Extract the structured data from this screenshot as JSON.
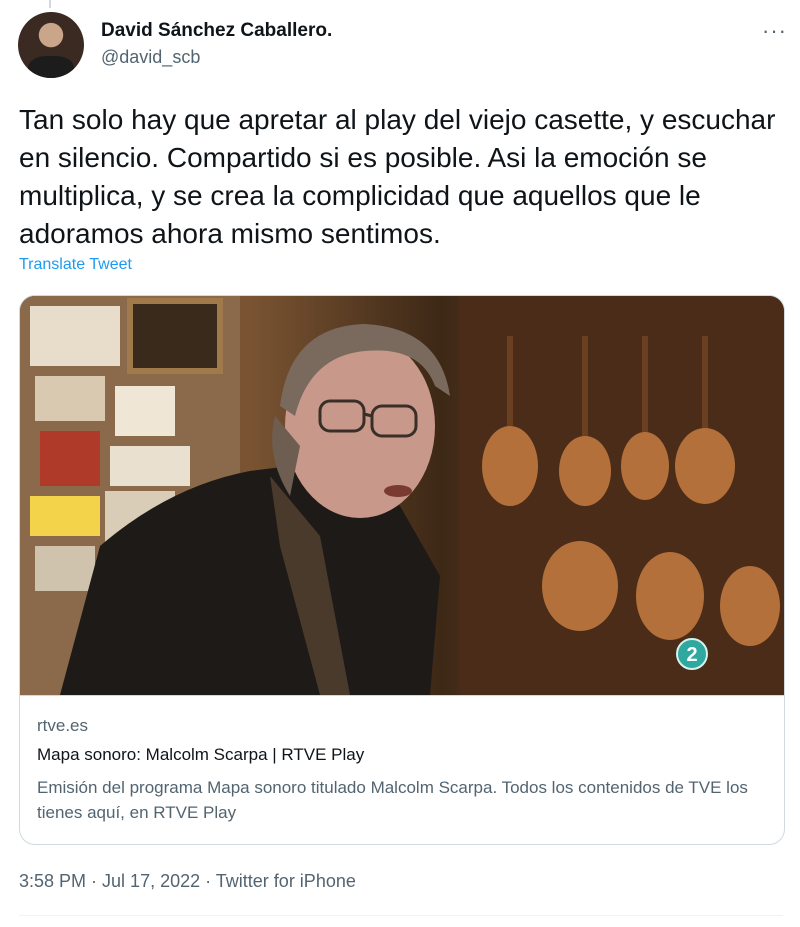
{
  "author": {
    "name": "David Sánchez Caballero.",
    "handle": "@david_scb"
  },
  "more_icon": "more-horizontal-icon",
  "more_glyph": "···",
  "tweet": {
    "text": "Tan solo hay que apretar al play del viejo casette, y escuchar en silencio. Compartido si es posible. Asi la emoción se multiplica, y se crea la complicidad que aquellos que le adoramos ahora mismo sentimos.",
    "translate_label": "Translate Tweet"
  },
  "card": {
    "domain": "rtve.es",
    "title": "Mapa sonoro: Malcolm Scarpa | RTVE Play",
    "description": "Emisión del programa Mapa sonoro titulado Malcolm Scarpa. Todos los contenidos de TVE los tienes aquí, en RTVE Play",
    "media_badge": "2"
  },
  "meta": {
    "time": "3:58 PM",
    "separator": " · ",
    "date": "Jul 17, 2022",
    "source": "Twitter for iPhone"
  },
  "colors": {
    "link": "#1d9bf0",
    "secondary_text": "#536471",
    "border": "#cfd9de"
  }
}
